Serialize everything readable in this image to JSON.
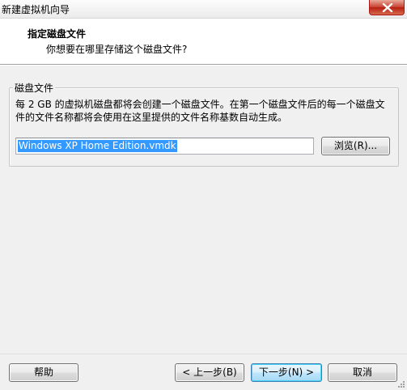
{
  "window": {
    "title": "新建虚拟机向导"
  },
  "header": {
    "title": "指定磁盘文件",
    "subtitle": "你想要在哪里存储这个磁盘文件?"
  },
  "group": {
    "legend": "磁盘文件",
    "description_line1": "每 2 GB 的虚拟机磁盘都将会创建一个磁盘文件。在第一个磁盘文件后的每一个磁盘文",
    "description_line2": "件的文件名称都将会使用在这里提供的文件名称基数自动生成。",
    "file_name_value": "Windows XP Home Edition.vmdk",
    "browse_label": "浏览(R)..."
  },
  "footer": {
    "help_label": "帮助",
    "back_label": "< 上一步(B)",
    "next_label": "下一步(N) >",
    "cancel_label": "取消"
  },
  "icons": {
    "close": "close-icon",
    "grip": "resize-grip-icon"
  }
}
